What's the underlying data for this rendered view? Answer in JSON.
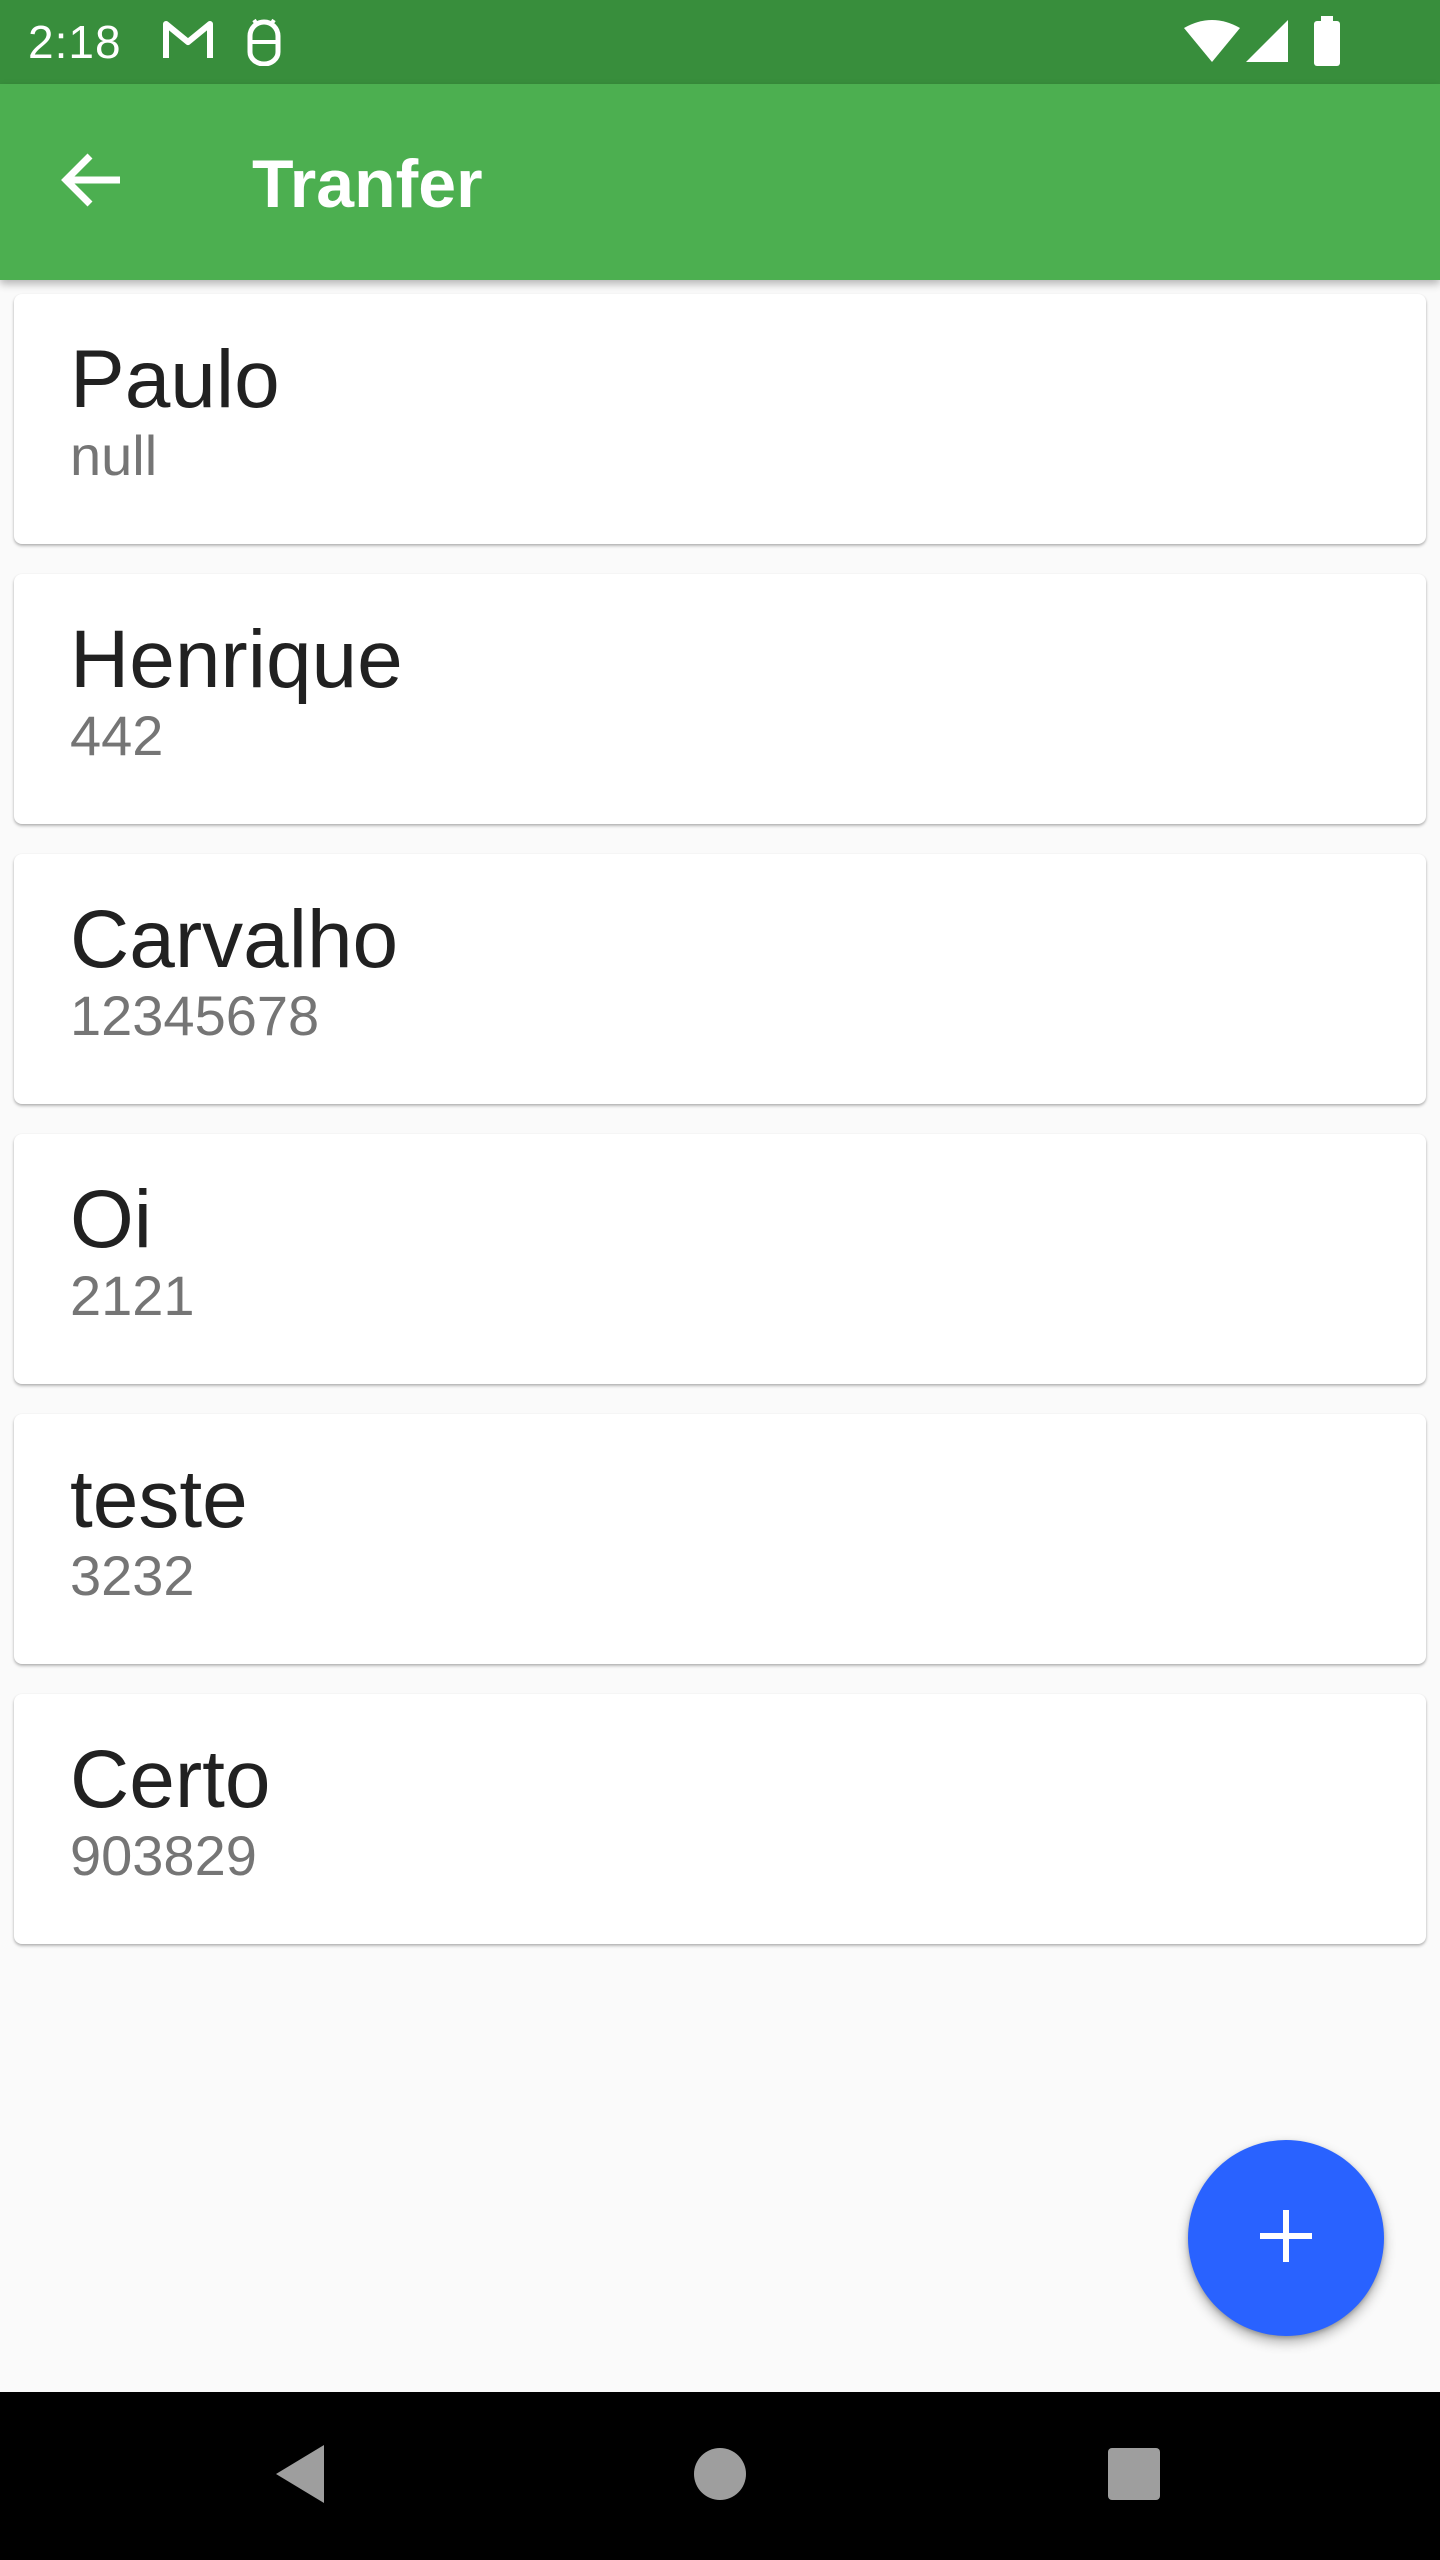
{
  "status_bar": {
    "time": "2:18",
    "left_icons": [
      "gmail-icon",
      "android-debug-icon"
    ],
    "right_icons": [
      "wifi-icon",
      "cellular-signal-icon",
      "battery-icon"
    ]
  },
  "app_bar": {
    "title": "Tranfer",
    "back_icon": "arrow-back-icon",
    "color": "#4caf50",
    "status_color": "#388e3c"
  },
  "contacts": [
    {
      "name": "Paulo",
      "number": "null"
    },
    {
      "name": "Henrique",
      "number": "442"
    },
    {
      "name": "Carvalho",
      "number": "12345678"
    },
    {
      "name": "Oi",
      "number": "2121"
    },
    {
      "name": "teste",
      "number": "3232"
    },
    {
      "name": "Certo",
      "number": "903829"
    }
  ],
  "fab": {
    "icon": "plus-icon",
    "color": "#2962ff"
  },
  "nav_bar": {
    "buttons": [
      "back-triangle-icon",
      "home-circle-icon",
      "recents-square-icon"
    ]
  }
}
